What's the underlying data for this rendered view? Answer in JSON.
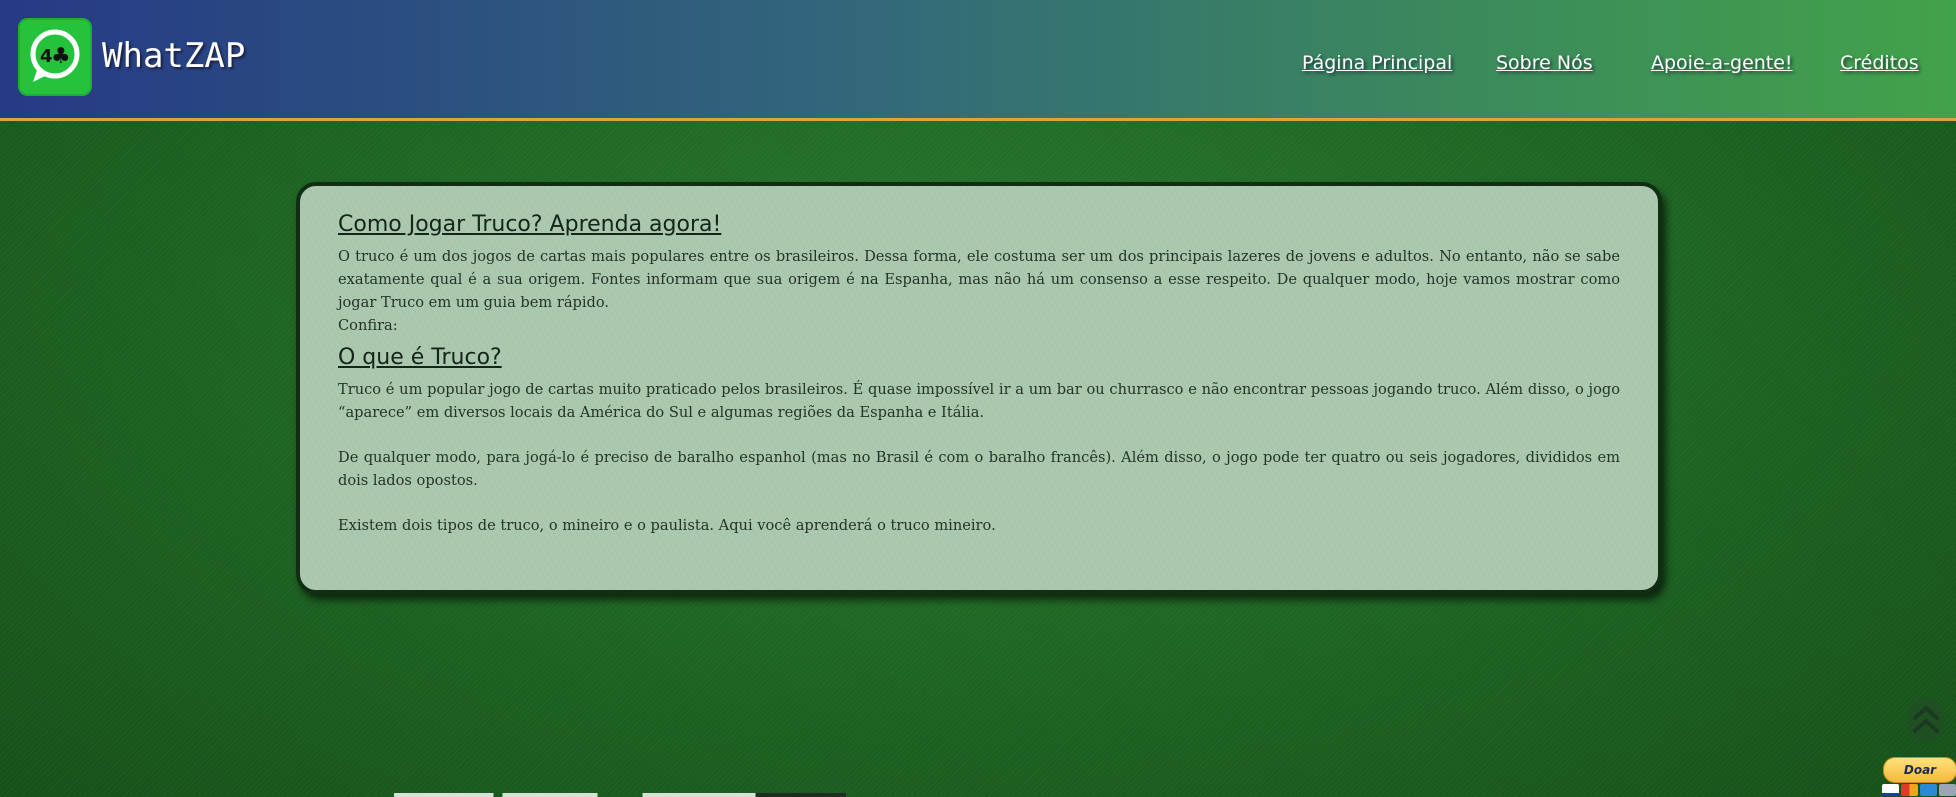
{
  "header": {
    "brand": "WhatZAP",
    "nav": {
      "home": "Página Principal",
      "about": "Sobre Nós",
      "support": "Apoie-a-gente!",
      "credits": "Créditos"
    }
  },
  "article": {
    "title": "Como Jogar Truco? Aprenda agora!",
    "intro": "O truco é um dos jogos de cartas mais populares entre os brasileiros. Dessa forma, ele costuma ser um dos principais lazeres de jovens e adultos. No entanto, não se sabe exatamente qual é a sua origem. Fontes informam que sua origem é na Espanha, mas não há um consenso a esse respeito. De qualquer modo, hoje vamos mostrar como jogar Truco em um guia bem rápido.",
    "confira": "Confira:",
    "section_title": "O que é Truco?",
    "paragraphs": [
      "Truco é um popular jogo de cartas muito praticado pelos brasileiros. É quase impossível ir a um bar ou churrasco e não encontrar pessoas jogando truco. Além disso, o jogo “aparece” em diversos locais da América do Sul e algumas regiões da Espanha e Itália.",
      "De qualquer modo, para jogá-lo é preciso de baralho espanhol (mas no Brasil é com o baralho francês). Além disso, o jogo pode ter quatro ou seis jogadores, divididos em dois lados opostos.",
      "Existem dois tipos de truco, o mineiro e o paulista. Aqui você aprenderá o truco mineiro."
    ]
  },
  "donate": {
    "label": "Doar"
  },
  "icons": {
    "logo": "whatsapp-club-logo-icon",
    "scroll_top": "double-chevron-up-icon",
    "payment": [
      "visa-icon",
      "mastercard-icon",
      "amex-icon",
      "card-icon"
    ]
  },
  "colors": {
    "header_gradient_start": "#263a86",
    "header_gradient_end": "#42a24a",
    "header_border": "#d4a83a",
    "felt_green": "#1f6a25",
    "card_bg": "#a9c7ac",
    "logo_green": "#25c23c"
  }
}
